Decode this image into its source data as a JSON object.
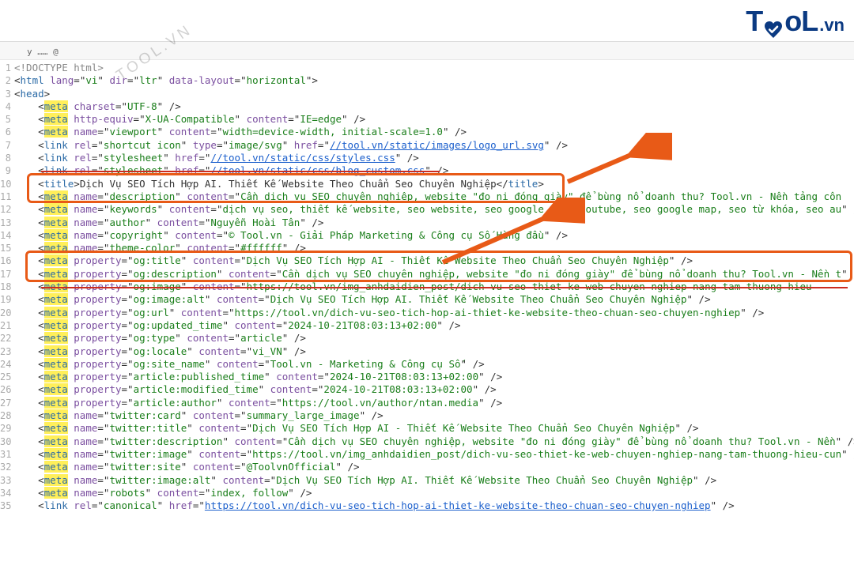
{
  "logo": {
    "t1": "T",
    "t2": "oL",
    "suffix": ".vn"
  },
  "watermark": "TOOL.VN",
  "tab_marker": "y …… @",
  "gutter_start": 1,
  "gutter_count": 35,
  "lines": [
    {
      "kind": "doctype",
      "raw": "<!DOCTYPE html>"
    },
    {
      "kind": "open",
      "tag": "html",
      "attrs": [
        [
          "lang",
          "vi"
        ],
        [
          "dir",
          "ltr"
        ],
        [
          "data-layout",
          "horizontal"
        ]
      ]
    },
    {
      "kind": "open",
      "tag": "head"
    },
    {
      "kind": "self",
      "indent": 2,
      "hl": true,
      "tag": "meta",
      "attrs": [
        [
          "charset",
          "UTF-8"
        ]
      ]
    },
    {
      "kind": "self",
      "indent": 2,
      "hl": true,
      "tag": "meta",
      "attrs": [
        [
          "http-equiv",
          "X-UA-Compatible"
        ],
        [
          "content",
          "IE=edge"
        ]
      ]
    },
    {
      "kind": "self",
      "indent": 2,
      "hl": true,
      "tag": "meta",
      "attrs": [
        [
          "name",
          "viewport"
        ],
        [
          "content",
          "width=device-width, initial-scale=1.0"
        ]
      ]
    },
    {
      "kind": "link",
      "indent": 2,
      "tag": "link",
      "attrs": [
        [
          "rel",
          "shortcut icon"
        ],
        [
          "type",
          "image/svg"
        ],
        [
          "href",
          "//tool.vn/static/images/logo_url.svg"
        ]
      ]
    },
    {
      "kind": "link",
      "indent": 2,
      "tag": "link",
      "attrs": [
        [
          "rel",
          "stylesheet"
        ],
        [
          "href",
          "//tool.vn/static/css/styles.css"
        ]
      ]
    },
    {
      "kind": "strike_link",
      "indent": 2,
      "text": "//tool.vn/static/css/blog_custom.css"
    },
    {
      "kind": "title",
      "indent": 2,
      "tag": "title",
      "text": "Dịch Vụ SEO Tích Hợp AI. Thiết Kế Website Theo Chuẩn Seo Chuyên Nghiệp"
    },
    {
      "kind": "strike_meta",
      "indent": 2,
      "text": "Cần dịch vụ SEO chuyên nghiệp, website \"đo ni đóng giày\" để bùng nổ doanh thu? Tool.vn - Nền tảng côn"
    },
    {
      "kind": "self",
      "indent": 2,
      "hl": true,
      "tag": "meta",
      "attrs": [
        [
          "name",
          "keywords"
        ],
        [
          "content",
          "dịch vụ seo, thiết kế website, seo website, seo google, seo youtube, seo google map, seo từ khóa, seo au"
        ]
      ]
    },
    {
      "kind": "self",
      "indent": 2,
      "hl": true,
      "tag": "meta",
      "attrs": [
        [
          "name",
          "author"
        ],
        [
          "content",
          "Nguyễn Hoài Tân"
        ]
      ]
    },
    {
      "kind": "self",
      "indent": 2,
      "hl": true,
      "tag": "meta",
      "attrs": [
        [
          "name",
          "copyright"
        ],
        [
          "content",
          "© Tool.vn - Giải Pháp Marketing & Công cụ Số Hàng đầu"
        ]
      ]
    },
    {
      "kind": "self",
      "indent": 2,
      "hl": true,
      "tag": "meta",
      "attrs": [
        [
          "name",
          "theme-color"
        ],
        [
          "content",
          "#ffffff"
        ]
      ]
    },
    {
      "kind": "self",
      "indent": 2,
      "hl": true,
      "tag": "meta",
      "attrs": [
        [
          "property",
          "og:title"
        ],
        [
          "content",
          "Dịch Vụ SEO Tích Hợp AI - Thiết Kế Website Theo Chuẩn Seo Chuyên Nghiệp"
        ]
      ]
    },
    {
      "kind": "self",
      "indent": 2,
      "hl": true,
      "tag": "meta",
      "attrs": [
        [
          "property",
          "og:description"
        ],
        [
          "content",
          "Cần dịch vụ SEO chuyên nghiệp, website \"đo ni đóng giày\" để bùng nổ doanh thu? Tool.vn - Nền t"
        ]
      ]
    },
    {
      "kind": "strike_meta2",
      "indent": 2,
      "text": "https://tool.vn/img_anhdaidien_post/dich-vu-seo-thiet-ke-web-chuyen-nghiep-nang-tam-thuong-hieu-"
    },
    {
      "kind": "self",
      "indent": 2,
      "hl": true,
      "tag": "meta",
      "attrs": [
        [
          "property",
          "og:image:alt"
        ],
        [
          "content",
          "Dịch Vụ SEO Tích Hợp AI. Thiết Kế Website Theo Chuẩn Seo Chuyên Nghiệp"
        ]
      ]
    },
    {
      "kind": "self",
      "indent": 2,
      "hl": true,
      "tag": "meta",
      "attrs": [
        [
          "property",
          "og:url"
        ],
        [
          "content",
          "https://tool.vn/dich-vu-seo-tich-hop-ai-thiet-ke-website-theo-chuan-seo-chuyen-nghiep"
        ]
      ]
    },
    {
      "kind": "self",
      "indent": 2,
      "hl": true,
      "tag": "meta",
      "attrs": [
        [
          "property",
          "og:updated_time"
        ],
        [
          "content",
          "2024-10-21T08:03:13+02:00"
        ]
      ]
    },
    {
      "kind": "self",
      "indent": 2,
      "hl": true,
      "tag": "meta",
      "attrs": [
        [
          "property",
          "og:type"
        ],
        [
          "content",
          "article"
        ]
      ]
    },
    {
      "kind": "self",
      "indent": 2,
      "hl": true,
      "tag": "meta",
      "attrs": [
        [
          "property",
          "og:locale"
        ],
        [
          "content",
          "vi_VN"
        ]
      ]
    },
    {
      "kind": "self",
      "indent": 2,
      "hl": true,
      "tag": "meta",
      "attrs": [
        [
          "property",
          "og:site_name"
        ],
        [
          "content",
          "Tool.vn - Marketing & Công cụ Số"
        ]
      ]
    },
    {
      "kind": "self",
      "indent": 2,
      "hl": true,
      "tag": "meta",
      "attrs": [
        [
          "property",
          "article:published_time"
        ],
        [
          "content",
          "2024-10-21T08:03:13+02:00"
        ]
      ]
    },
    {
      "kind": "self",
      "indent": 2,
      "hl": true,
      "tag": "meta",
      "attrs": [
        [
          "property",
          "article:modified_time"
        ],
        [
          "content",
          "2024-10-21T08:03:13+02:00"
        ]
      ]
    },
    {
      "kind": "self",
      "indent": 2,
      "hl": true,
      "tag": "meta",
      "attrs": [
        [
          "property",
          "article:author"
        ],
        [
          "content",
          "https://tool.vn/author/ntan.media"
        ]
      ]
    },
    {
      "kind": "self",
      "indent": 2,
      "hl": true,
      "tag": "meta",
      "attrs": [
        [
          "name",
          "twitter:card"
        ],
        [
          "content",
          "summary_large_image"
        ]
      ]
    },
    {
      "kind": "self",
      "indent": 2,
      "hl": true,
      "tag": "meta",
      "attrs": [
        [
          "name",
          "twitter:title"
        ],
        [
          "content",
          "Dịch Vụ SEO Tích Hợp AI - Thiết Kế Website Theo Chuẩn Seo Chuyên Nghiệp"
        ]
      ]
    },
    {
      "kind": "self",
      "indent": 2,
      "hl": true,
      "tag": "meta",
      "attrs": [
        [
          "name",
          "twitter:description"
        ],
        [
          "content",
          "Cần dịch vụ SEO chuyên nghiệp, website \"đo ni đóng giày\" để bùng nổ doanh thu? Tool.vn - Nền"
        ]
      ]
    },
    {
      "kind": "self",
      "indent": 2,
      "hl": true,
      "tag": "meta",
      "attrs": [
        [
          "name",
          "twitter:image"
        ],
        [
          "content",
          "https://tool.vn/img_anhdaidien_post/dich-vu-seo-thiet-ke-web-chuyen-nghiep-nang-tam-thuong-hieu-cun"
        ]
      ]
    },
    {
      "kind": "self",
      "indent": 2,
      "hl": true,
      "tag": "meta",
      "attrs": [
        [
          "name",
          "twitter:site"
        ],
        [
          "content",
          "@ToolvnOfficial"
        ]
      ]
    },
    {
      "kind": "self",
      "indent": 2,
      "hl": true,
      "tag": "meta",
      "attrs": [
        [
          "name",
          "twitter:image:alt"
        ],
        [
          "content",
          "Dịch Vụ SEO Tích Hợp AI. Thiết Kế Website Theo Chuẩn Seo Chuyên Nghiệp"
        ]
      ]
    },
    {
      "kind": "self",
      "indent": 2,
      "hl": true,
      "tag": "meta",
      "attrs": [
        [
          "name",
          "robots"
        ],
        [
          "content",
          "index, follow"
        ]
      ]
    },
    {
      "kind": "link",
      "indent": 2,
      "tag": "link",
      "attrs": [
        [
          "rel",
          "canonical"
        ],
        [
          "href",
          "https://tool.vn/dich-vu-seo-tich-hop-ai-thiet-ke-website-theo-chuan-seo-chuyen-nghiep"
        ]
      ]
    }
  ]
}
